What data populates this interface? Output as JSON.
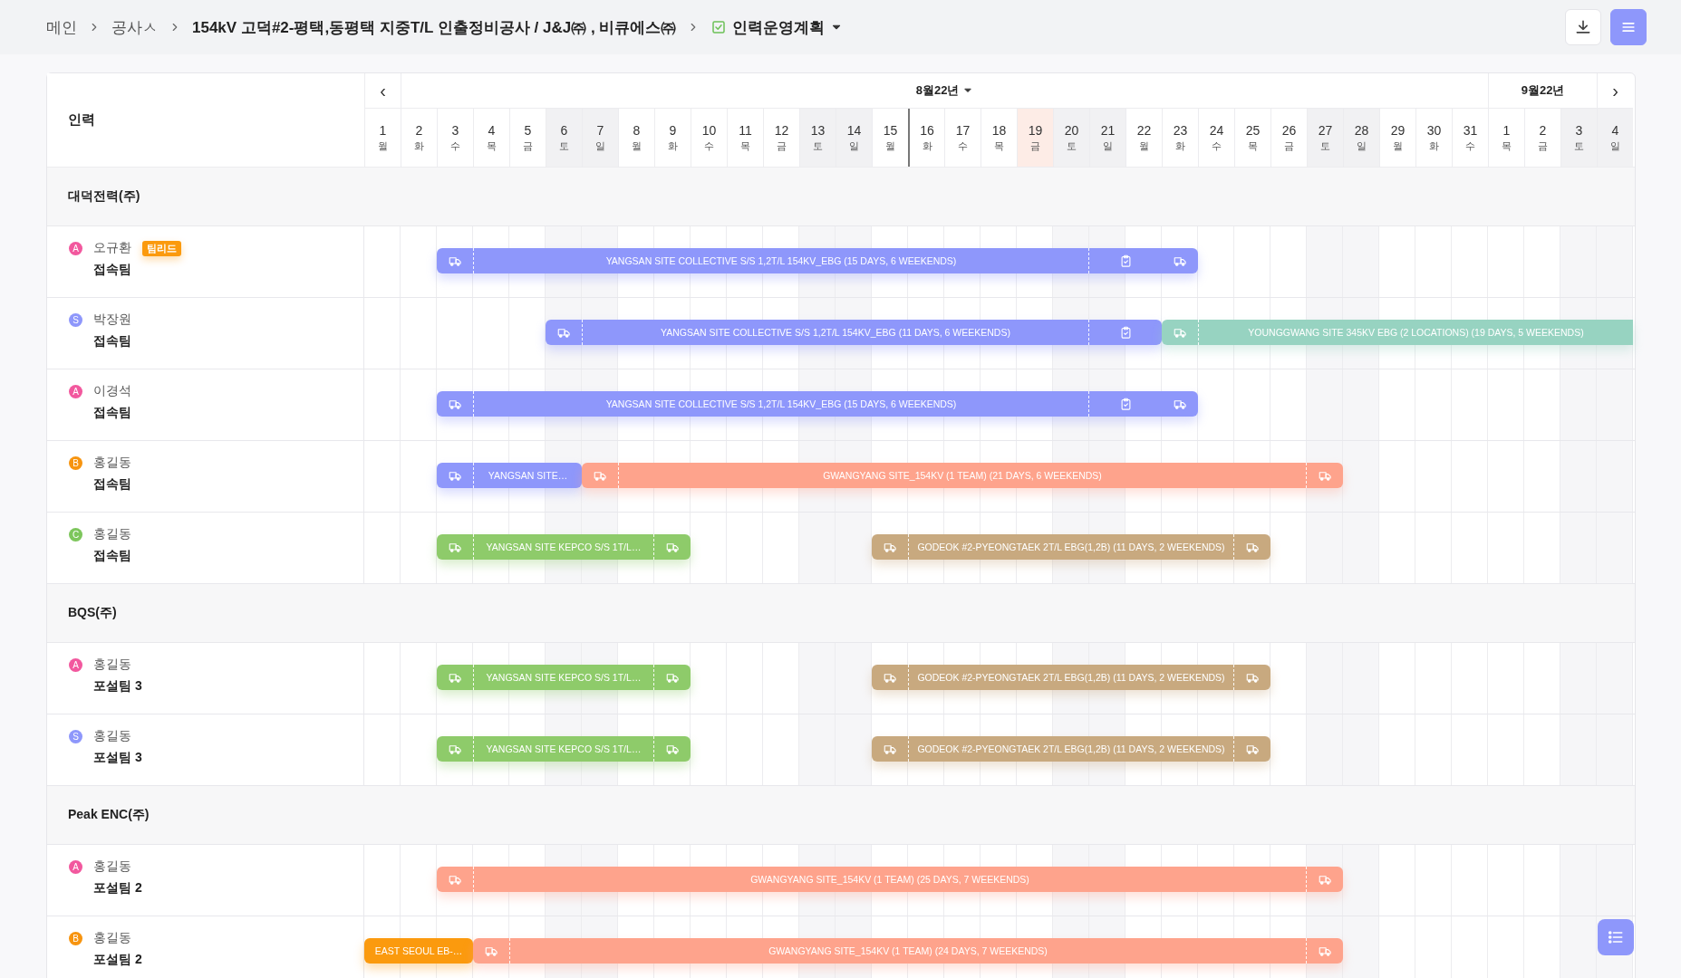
{
  "breadcrumb": [
    {
      "label": "메인",
      "strong": false
    },
    {
      "label": "공사ㅅ",
      "strong": false
    },
    {
      "label": "154kV 고덕#2-평택,동평택 지중T/L 인출정비공사 / J&J㈜ , 비큐에스㈜",
      "strong": true
    }
  ],
  "plan": {
    "label": "인력운영계획",
    "checked": true
  },
  "toolbar": {
    "download": true,
    "menu_selected": true
  },
  "table": {
    "people_header": "인력",
    "prev": "‹",
    "next": "›",
    "months": [
      {
        "label": "8월22년",
        "dropdown": true,
        "days": [
          {
            "day": "1",
            "weekday": "월",
            "weekend": false,
            "today": false,
            "marked": false
          },
          {
            "day": "2",
            "weekday": "화",
            "weekend": false,
            "today": false,
            "marked": false
          },
          {
            "day": "3",
            "weekday": "수",
            "weekend": false,
            "today": false,
            "marked": false
          },
          {
            "day": "4",
            "weekday": "목",
            "weekend": false,
            "today": false,
            "marked": false
          },
          {
            "day": "5",
            "weekday": "금",
            "weekend": false,
            "today": false,
            "marked": false
          },
          {
            "day": "6",
            "weekday": "토",
            "weekend": true,
            "today": false,
            "marked": false
          },
          {
            "day": "7",
            "weekday": "일",
            "weekend": true,
            "today": false,
            "marked": false
          },
          {
            "day": "8",
            "weekday": "월",
            "weekend": false,
            "today": false,
            "marked": false
          },
          {
            "day": "9",
            "weekday": "화",
            "weekend": false,
            "today": false,
            "marked": false
          },
          {
            "day": "10",
            "weekday": "수",
            "weekend": false,
            "today": false,
            "marked": false
          },
          {
            "day": "11",
            "weekday": "목",
            "weekend": false,
            "today": false,
            "marked": false
          },
          {
            "day": "12",
            "weekday": "금",
            "weekend": false,
            "today": false,
            "marked": false
          },
          {
            "day": "13",
            "weekday": "토",
            "weekend": true,
            "today": false,
            "marked": false
          },
          {
            "day": "14",
            "weekday": "일",
            "weekend": true,
            "today": false,
            "marked": false
          },
          {
            "day": "15",
            "weekday": "월",
            "weekend": false,
            "today": false,
            "marked": false
          },
          {
            "day": "16",
            "weekday": "화",
            "weekend": false,
            "today": false,
            "marked": true
          },
          {
            "day": "17",
            "weekday": "수",
            "weekend": false,
            "today": false,
            "marked": false
          },
          {
            "day": "18",
            "weekday": "목",
            "weekend": false,
            "today": false,
            "marked": false
          },
          {
            "day": "19",
            "weekday": "금",
            "weekend": false,
            "today": true,
            "marked": false
          },
          {
            "day": "20",
            "weekday": "토",
            "weekend": true,
            "today": false,
            "marked": false
          },
          {
            "day": "21",
            "weekday": "일",
            "weekend": true,
            "today": false,
            "marked": false
          },
          {
            "day": "22",
            "weekday": "월",
            "weekend": false,
            "today": false,
            "marked": false
          },
          {
            "day": "23",
            "weekday": "화",
            "weekend": false,
            "today": false,
            "marked": false
          },
          {
            "day": "24",
            "weekday": "수",
            "weekend": false,
            "today": false,
            "marked": false
          },
          {
            "day": "25",
            "weekday": "목",
            "weekend": false,
            "today": false,
            "marked": false
          },
          {
            "day": "26",
            "weekday": "금",
            "weekend": false,
            "today": false,
            "marked": false
          },
          {
            "day": "27",
            "weekday": "토",
            "weekend": true,
            "today": false,
            "marked": false
          },
          {
            "day": "28",
            "weekday": "일",
            "weekend": true,
            "today": false,
            "marked": false
          },
          {
            "day": "29",
            "weekday": "월",
            "weekend": false,
            "today": false,
            "marked": false
          },
          {
            "day": "30",
            "weekday": "화",
            "weekend": false,
            "today": false,
            "marked": false
          },
          {
            "day": "31",
            "weekday": "수",
            "weekend": false,
            "today": false,
            "marked": false
          }
        ]
      },
      {
        "label": "9월22년",
        "dropdown": false,
        "days": [
          {
            "day": "1",
            "weekday": "목",
            "weekend": false,
            "today": false,
            "marked": false
          },
          {
            "day": "2",
            "weekday": "금",
            "weekend": false,
            "today": false,
            "marked": false
          },
          {
            "day": "3",
            "weekday": "토",
            "weekend": true,
            "today": false,
            "marked": false
          },
          {
            "day": "4",
            "weekday": "일",
            "weekend": true,
            "today": false,
            "marked": false
          }
        ]
      }
    ],
    "groups": [
      {
        "name": "대덕전력(주)",
        "people": [
          {
            "avatar": "A",
            "color": "#f2589e",
            "name": "오규환",
            "badge": "팀리드",
            "team": "접속팀",
            "bars": [
              {
                "color": "#8e97fb",
                "clipped": false,
                "segments": [
                  {
                    "kind": "truck"
                  },
                  {
                    "kind": "label",
                    "text": "YANGSAN SITE COLLECTIVE S/S 1,2T/L 154KV_EBG (15 DAYS, 6 WEEKENDS)"
                  },
                  {
                    "kind": "clipboard"
                  },
                  {
                    "kind": "truck"
                  }
                ]
              }
            ]
          },
          {
            "avatar": "S",
            "color": "#8e97fb",
            "name": "박장원",
            "team": "접속팀",
            "bars": [
              {
                "color": "#8e97fb",
                "clipped": false,
                "segments": [
                  {
                    "kind": "truck"
                  },
                  {
                    "kind": "label",
                    "text": "YANGSAN SITE COLLECTIVE S/S 1,2T/L 154KV_EBG (11 DAYS, 6 WEEKENDS)"
                  },
                  {
                    "kind": "clipboard"
                  }
                ]
              },
              {
                "color": "#97d3c1",
                "clipped": true,
                "segments": [
                  {
                    "kind": "truck"
                  },
                  {
                    "kind": "label",
                    "text": "YOUNGGWANG SITE 345KV EBG (2 LOCATIONS)  (19 DAYS, 5 WEEKENDS)"
                  }
                ]
              }
            ]
          },
          {
            "avatar": "A",
            "color": "#f2589e",
            "name": "이경석",
            "team": "접속팀",
            "bars": [
              {
                "color": "#8e97fb",
                "clipped": false,
                "segments": [
                  {
                    "kind": "truck"
                  },
                  {
                    "kind": "label",
                    "text": "YANGSAN SITE COLLECTIVE S/S 1,2T/L 154KV_EBG (15 DAYS, 6 WEEKENDS)"
                  },
                  {
                    "kind": "clipboard"
                  },
                  {
                    "kind": "truck"
                  }
                ]
              }
            ]
          },
          {
            "avatar": "B",
            "color": "#f7940f",
            "name": "홍길동",
            "team": "접속팀",
            "bars": [
              {
                "color": "#8e97fb",
                "clipped": false,
                "segments": [
                  {
                    "kind": "truck"
                  },
                  {
                    "kind": "label",
                    "text": "YANGSAN SITE…"
                  }
                ]
              },
              {
                "color": "#fea38c",
                "clipped": false,
                "segments": [
                  {
                    "kind": "truck"
                  },
                  {
                    "kind": "label",
                    "text": "GWANGYANG SITE_154KV (1 TEAM)  (21 DAYS, 6 WEEKENDS)"
                  },
                  {
                    "kind": "truck"
                  }
                ]
              }
            ]
          },
          {
            "avatar": "C",
            "color": "#7dc65c",
            "name": "홍길동",
            "team": "접속팀",
            "bars": [
              {
                "color": "#8ecb6a",
                "clipped": false,
                "segments": [
                  {
                    "kind": "truck"
                  },
                  {
                    "kind": "label",
                    "text": "YANGSAN SITE KEPCO S/S 1T/L…"
                  },
                  {
                    "kind": "truck"
                  }
                ]
              },
              {
                "color": "#c8a97f",
                "clipped": false,
                "segments": [
                  {
                    "kind": "truck"
                  },
                  {
                    "kind": "label",
                    "text": "GODEOK #2-PYEONGTAEK 2T/L EBG(1,2B)  (11 DAYS, 2 WEEKENDS)"
                  },
                  {
                    "kind": "truck"
                  }
                ]
              }
            ]
          }
        ]
      },
      {
        "name": "BQS(주)",
        "people": [
          {
            "avatar": "A",
            "color": "#f2589e",
            "name": "홍길동",
            "team": "포설팀 3",
            "bars": [
              {
                "color": "#8ecb6a",
                "clipped": false,
                "segments": [
                  {
                    "kind": "truck"
                  },
                  {
                    "kind": "label",
                    "text": "YANGSAN SITE KEPCO S/S 1T/L…"
                  },
                  {
                    "kind": "truck"
                  }
                ]
              },
              {
                "color": "#c8a97f",
                "clipped": false,
                "segments": [
                  {
                    "kind": "truck"
                  },
                  {
                    "kind": "label",
                    "text": "GODEOK #2-PYEONGTAEK 2T/L EBG(1,2B)  (11 DAYS, 2 WEEKENDS)"
                  },
                  {
                    "kind": "truck"
                  }
                ]
              }
            ]
          },
          {
            "avatar": "S",
            "color": "#8e97fb",
            "name": "홍길동",
            "team": "포설팀 3",
            "bars": [
              {
                "color": "#8ecb6a",
                "clipped": false,
                "segments": [
                  {
                    "kind": "truck"
                  },
                  {
                    "kind": "label",
                    "text": "YANGSAN SITE KEPCO S/S 1T/L…"
                  },
                  {
                    "kind": "truck"
                  }
                ]
              },
              {
                "color": "#c8a97f",
                "clipped": false,
                "segments": [
                  {
                    "kind": "truck"
                  },
                  {
                    "kind": "label",
                    "text": "GODEOK #2-PYEONGTAEK 2T/L EBG(1,2B)  (11 DAYS, 2 WEEKENDS)"
                  },
                  {
                    "kind": "truck"
                  }
                ]
              }
            ]
          }
        ]
      },
      {
        "name": "Peak ENC(주)",
        "people": [
          {
            "avatar": "A",
            "color": "#f2589e",
            "name": "홍길동",
            "team": "포설팀 2",
            "bars": [
              {
                "color": "#fea38c",
                "clipped": false,
                "segments": [
                  {
                    "kind": "truck"
                  },
                  {
                    "kind": "label",
                    "text": "GWANGYANG SITE_154KV (1 TEAM)  (25 DAYS, 7 WEEKENDS)"
                  },
                  {
                    "kind": "truck"
                  }
                ]
              }
            ]
          },
          {
            "avatar": "B",
            "color": "#f7940f",
            "name": "홍길동",
            "team": "포설팀 2",
            "bars": [
              {
                "color": "#fb9a0e",
                "clipped": false,
                "segments": [
                  {
                    "kind": "label",
                    "text": "EAST SEOUL EB-…"
                  }
                ]
              },
              {
                "color": "#fea38c",
                "clipped": false,
                "segments": [
                  {
                    "kind": "truck"
                  },
                  {
                    "kind": "label",
                    "text": "GWANGYANG SITE_154KV (1 TEAM)  (24 DAYS, 7 WEEKENDS)"
                  },
                  {
                    "kind": "truck"
                  }
                ]
              }
            ]
          }
        ]
      }
    ]
  },
  "fab": {
    "list": true
  }
}
